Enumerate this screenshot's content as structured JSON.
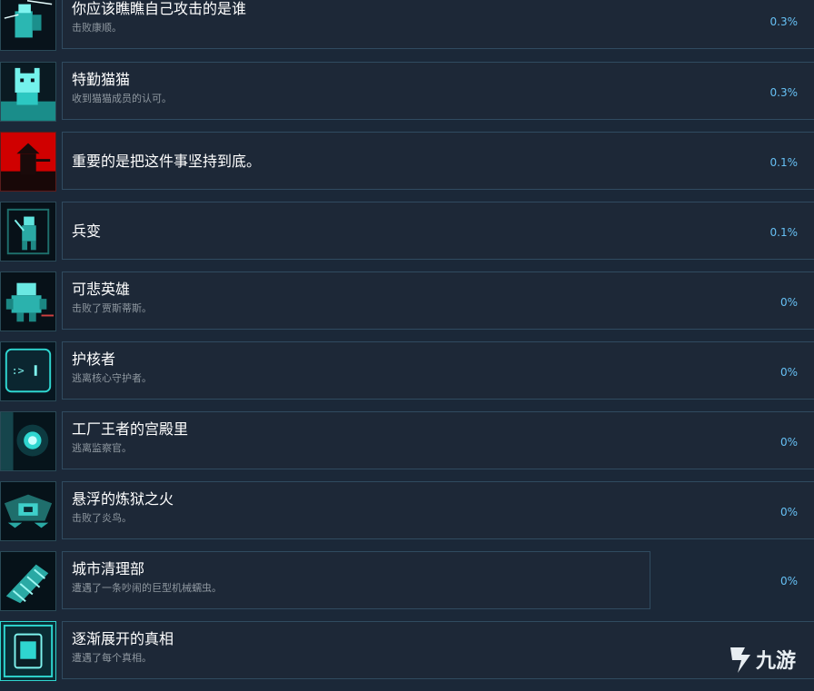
{
  "achievements": [
    {
      "title": "你应该瞧瞧自己攻击的是谁",
      "desc": "击败康顺。",
      "percent": "0.3%",
      "icon": "robot-warrior-icon"
    },
    {
      "title": "特勤猫猫",
      "desc": "收到猫猫成员的认可。",
      "percent": "0.3%",
      "icon": "cat-icon"
    },
    {
      "title": "重要的是把这件事坚持到底。",
      "desc": "",
      "percent": "0.1%",
      "icon": "red-sunset-samurai-icon"
    },
    {
      "title": "兵变",
      "desc": "",
      "percent": "0.1%",
      "icon": "soldier-icon"
    },
    {
      "title": "可悲英雄",
      "desc": "击败了贾斯蒂斯。",
      "percent": "0%",
      "icon": "hero-robot-icon"
    },
    {
      "title": "护核者",
      "desc": "逃离核心守护者。",
      "percent": "0%",
      "icon": "terminal-face-icon"
    },
    {
      "title": "工厂王者的宫殿里",
      "desc": "逃离监察官。",
      "percent": "0%",
      "icon": "eye-orb-icon"
    },
    {
      "title": "悬浮的炼狱之火",
      "desc": "击败了炎鸟。",
      "percent": "0%",
      "icon": "fire-bird-icon"
    },
    {
      "title": "城市清理部",
      "desc": "遭遇了一条吵闹的巨型机械蠕虫。",
      "percent": "0%",
      "icon": "mech-worm-icon"
    },
    {
      "title": "逐渐展开的真相",
      "desc": "遭遇了每个真相。",
      "percent": "",
      "icon": "chip-icon"
    }
  ],
  "watermark": {
    "text": "九游"
  },
  "colors": {
    "accent": "#66c0f4",
    "cyan": "#2fd6d0",
    "red": "#d40000"
  }
}
